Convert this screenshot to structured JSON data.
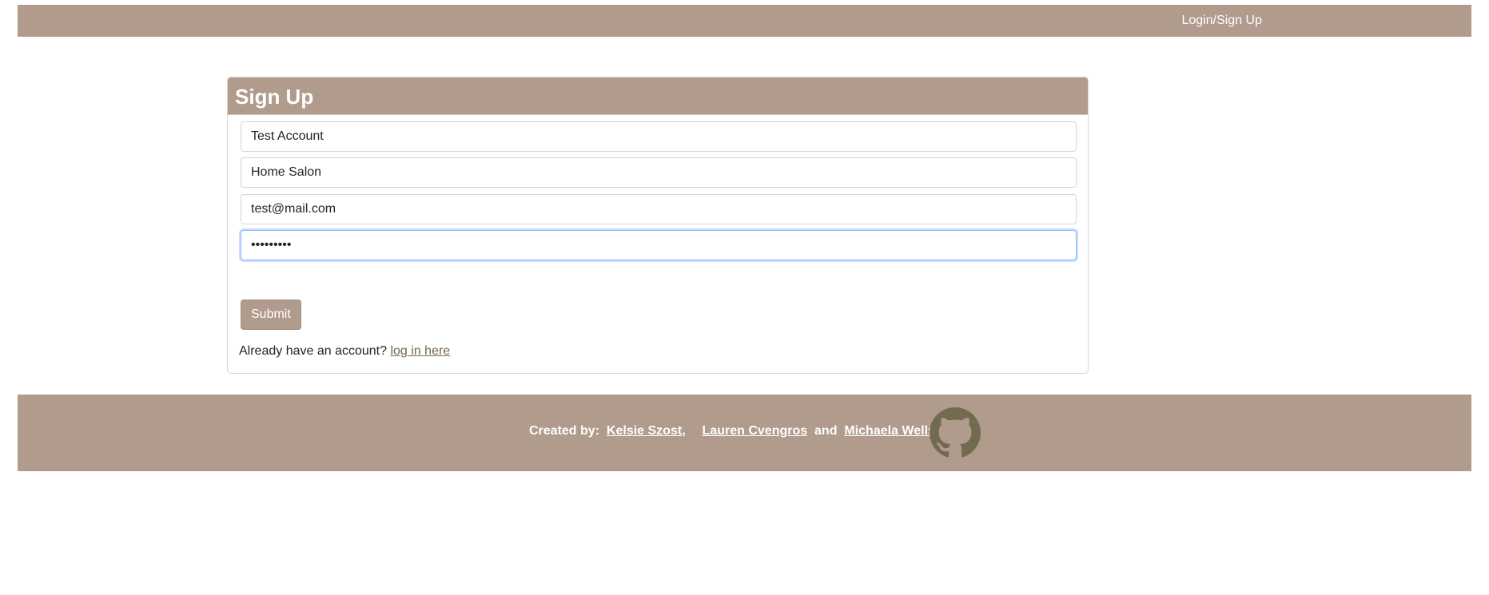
{
  "navbar": {
    "login_signup_link": "Login/Sign Up"
  },
  "signup_card": {
    "title": "Sign Up",
    "fields": {
      "name_value": "Test Account",
      "salon_value": "Home Salon",
      "email_value": "test@mail.com",
      "password_value": "•••••••••"
    },
    "submit_label": "Submit",
    "already_text": "Already have an account?",
    "login_link_label": "log in here"
  },
  "footer": {
    "created_by_label": "Created by:",
    "creators": [
      "Kelsie Szost",
      "Lauren Cvengros",
      "Michaela Wells"
    ],
    "comma": ",",
    "and_text": "and",
    "github_icon": "github-icon",
    "icon_color": "#736b50"
  },
  "colors": {
    "brand": "#b09b8c",
    "link": "#75664f"
  }
}
